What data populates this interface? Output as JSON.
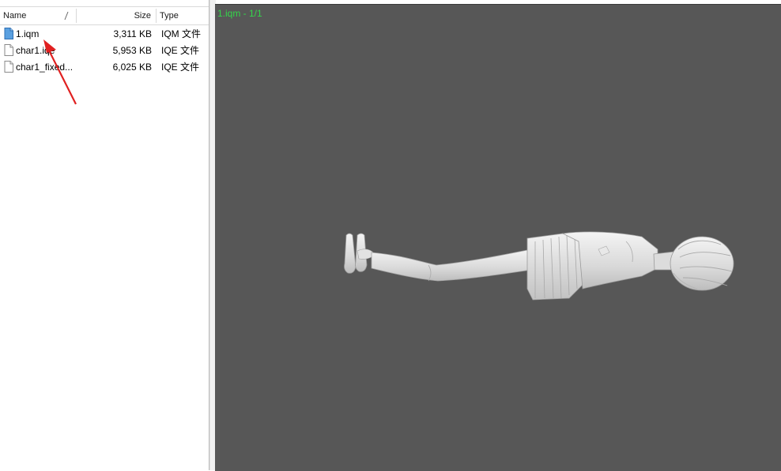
{
  "file_list": {
    "columns": {
      "name": "Name",
      "size": "Size",
      "type": "Type"
    },
    "files": [
      {
        "name": "1.iqm",
        "size": "3,311 KB",
        "type": "IQM 文件",
        "icon": "iqm-file-icon"
      },
      {
        "name": "char1.iqe",
        "size": "5,953 KB",
        "type": "IQE 文件",
        "icon": "blank-file-icon"
      },
      {
        "name": "char1_fixed...",
        "size": "6,025 KB",
        "type": "IQE 文件",
        "icon": "blank-file-icon"
      }
    ]
  },
  "viewport": {
    "title": "1.iqm - 1/1",
    "background_color": "#575757",
    "title_color": "#34d64a"
  },
  "annotation": {
    "color": "#e02020",
    "icon": "red-arrow"
  }
}
